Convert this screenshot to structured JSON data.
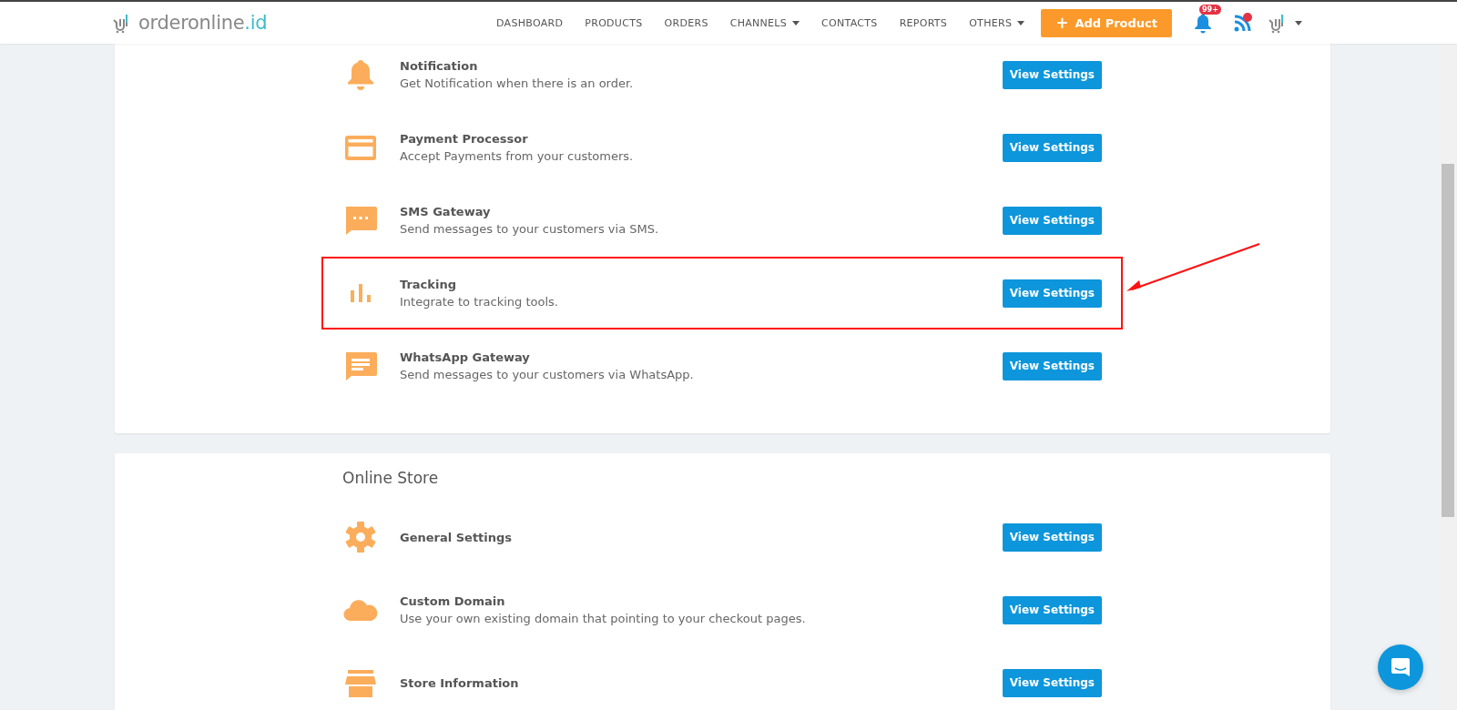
{
  "header": {
    "logo": {
      "name": "orderonline",
      "suffix": ".id"
    },
    "nav": [
      {
        "label": "DASHBOARD",
        "dropdown": false
      },
      {
        "label": "PRODUCTS",
        "dropdown": false
      },
      {
        "label": "ORDERS",
        "dropdown": false
      },
      {
        "label": "CHANNELS",
        "dropdown": true
      },
      {
        "label": "CONTACTS",
        "dropdown": false
      },
      {
        "label": "REPORTS",
        "dropdown": false
      },
      {
        "label": "OTHERS",
        "dropdown": true
      }
    ],
    "add_button": {
      "icon": "+",
      "label": "Add Product"
    },
    "notification_badge": "99+"
  },
  "sections": [
    {
      "items": [
        {
          "kind": "bell",
          "title": "Notification",
          "description": "Get Notification when there is an order.",
          "button": "View Settings",
          "highlighted": false
        },
        {
          "kind": "card",
          "title": "Payment Processor",
          "description": "Accept Payments from your customers.",
          "button": "View Settings",
          "highlighted": false
        },
        {
          "kind": "sms",
          "title": "SMS Gateway",
          "description": "Send messages to your customers via SMS.",
          "button": "View Settings",
          "highlighted": false
        },
        {
          "kind": "chart",
          "title": "Tracking",
          "description": "Integrate to tracking tools.",
          "button": "View Settings",
          "highlighted": true
        },
        {
          "kind": "message",
          "title": "WhatsApp Gateway",
          "description": "Send messages to your customers via WhatsApp.",
          "button": "View Settings",
          "highlighted": false
        }
      ]
    },
    {
      "title": "Online Store",
      "items": [
        {
          "kind": "gear",
          "title": "General Settings",
          "button": "View Settings",
          "highlighted": false
        },
        {
          "kind": "cloud",
          "title": "Custom Domain",
          "description": "Use your own existing domain that pointing to your checkout pages.",
          "button": "View Settings",
          "highlighted": false
        },
        {
          "kind": "store",
          "title": "Store Information",
          "button": "View Settings",
          "highlighted": false
        }
      ]
    }
  ]
}
